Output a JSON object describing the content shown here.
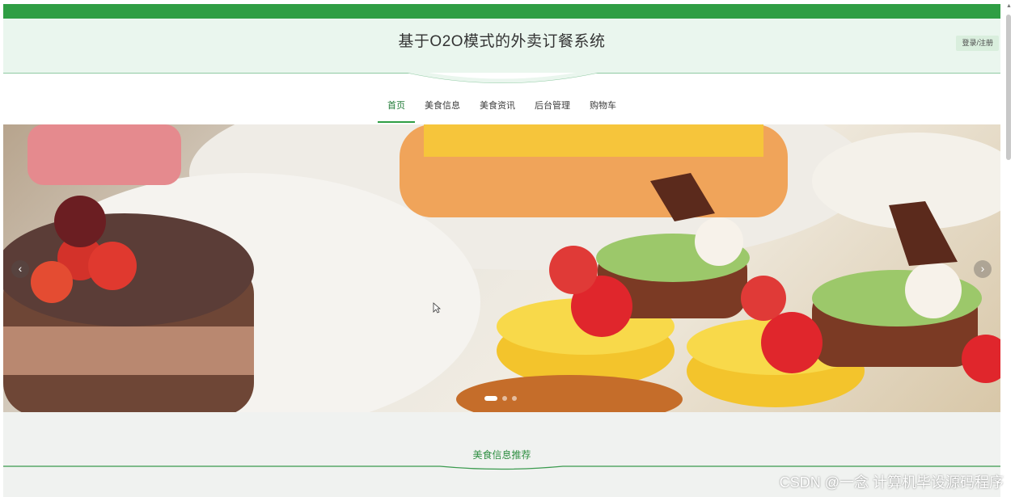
{
  "header": {
    "title": "基于O2O模式的外卖订餐系统",
    "login_label": "登录/注册"
  },
  "nav": {
    "items": [
      {
        "label": "首页",
        "active": true
      },
      {
        "label": "美食信息"
      },
      {
        "label": "美食资讯"
      },
      {
        "label": "后台管理"
      },
      {
        "label": "购物车"
      }
    ]
  },
  "banner": {
    "prev_icon": "‹",
    "next_icon": "›",
    "slides": 3,
    "active_slide": 1
  },
  "section": {
    "title": "美食信息推荐"
  },
  "watermark": "CSDN @一念 计算机毕设源码程序",
  "colors": {
    "accent": "#2f9e44",
    "header_bg": "#eaf6ee"
  }
}
